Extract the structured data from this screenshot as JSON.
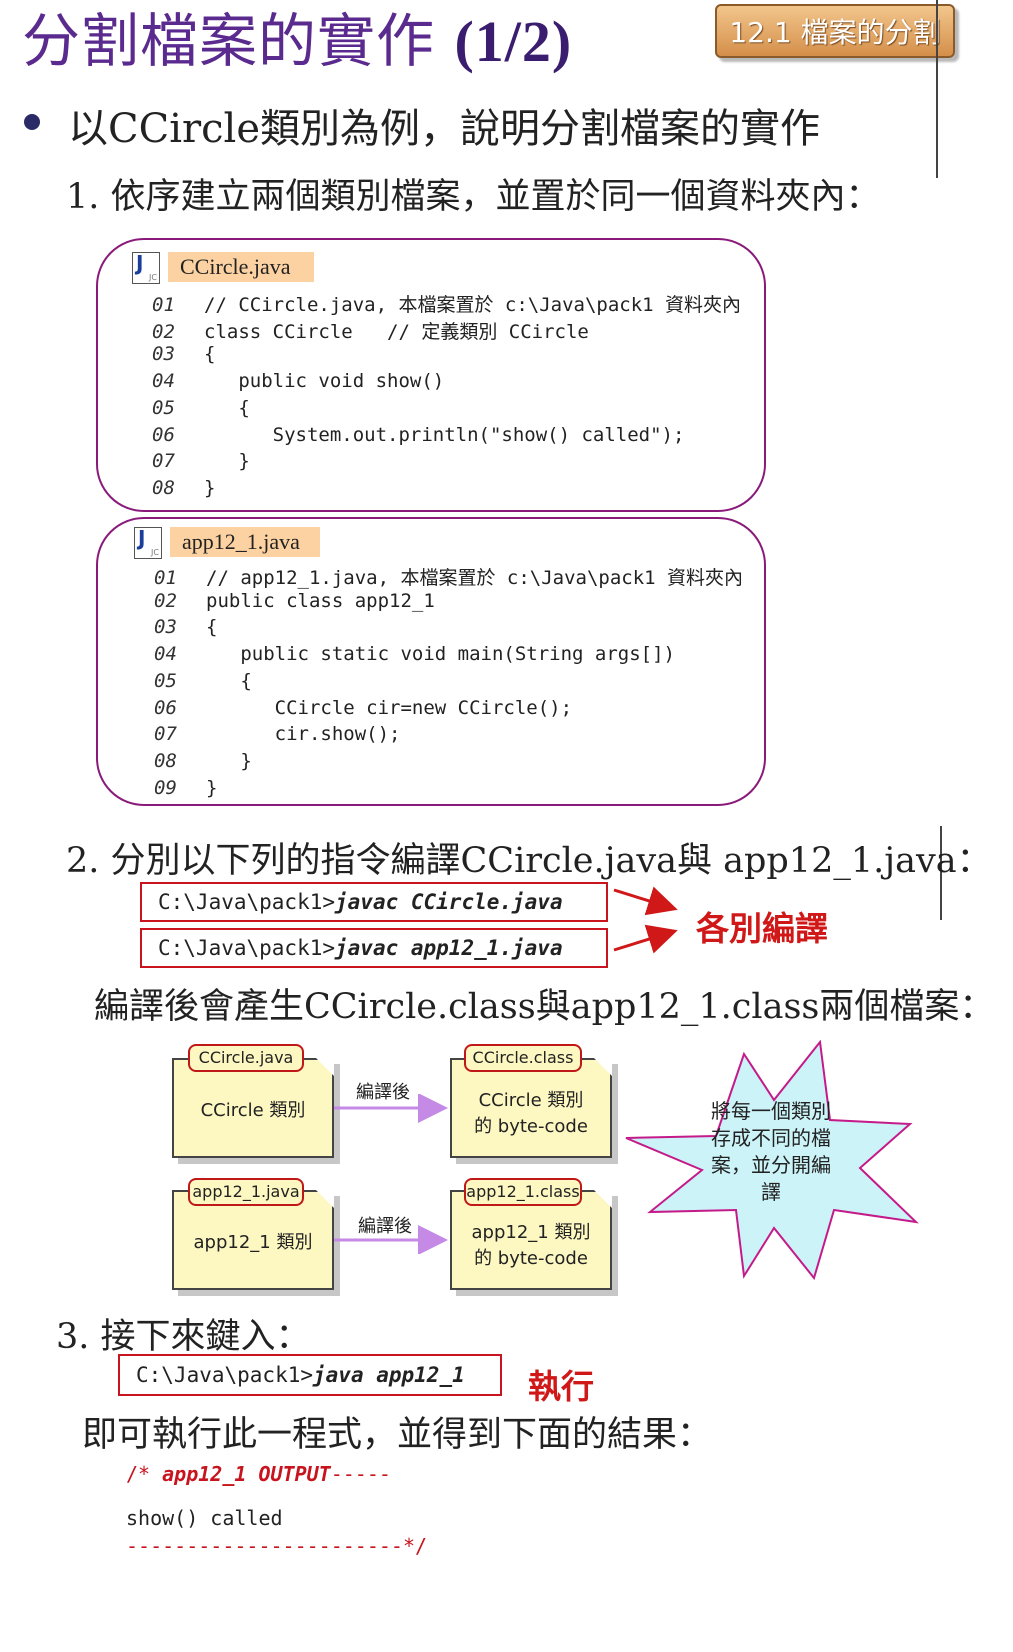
{
  "header": {
    "title_text": "分割檔案的實作 ",
    "title_num": "(1/2)",
    "badge": "12.1  檔案的分割"
  },
  "bullet": "以CCircle類別為例，說明分割檔案的實作",
  "step1": "1. 依序建立兩個類別檔案，並置於同一個資料夾內：",
  "file1": {
    "name": "CCircle.java",
    "lines": [
      {
        "n": "01",
        "code": "// CCircle.java, 本檔案置於 c:\\Java\\pack1 資料夾內"
      },
      {
        "n": "02",
        "code": "class CCircle   // 定義類別 CCircle"
      },
      {
        "n": "03",
        "code": "{"
      },
      {
        "n": "04",
        "code": "   public void show()"
      },
      {
        "n": "05",
        "code": "   {"
      },
      {
        "n": "06",
        "code": "      System.out.println(\"show() called\");"
      },
      {
        "n": "07",
        "code": "   }"
      },
      {
        "n": "08",
        "code": "}"
      }
    ]
  },
  "file2": {
    "name": "app12_1.java",
    "lines": [
      {
        "n": "01",
        "code": "// app12_1.java, 本檔案置於 c:\\Java\\pack1 資料夾內"
      },
      {
        "n": "02",
        "code": "public class app12_1"
      },
      {
        "n": "03",
        "code": "{"
      },
      {
        "n": "04",
        "code": "   public static void main(String args[])"
      },
      {
        "n": "05",
        "code": "   {"
      },
      {
        "n": "06",
        "code": "      CCircle cir=new CCircle();"
      },
      {
        "n": "07",
        "code": "      cir.show();"
      },
      {
        "n": "08",
        "code": "   }"
      },
      {
        "n": "09",
        "code": "}"
      }
    ]
  },
  "step2": "2. 分別以下列的指令編譯CCircle.java與 app12_1.java：",
  "compile": {
    "prompt": "C:\\Java\\pack1>",
    "cmd1": "javac CCircle.java",
    "cmd2": "javac app12_1.java",
    "label": "各別編譯"
  },
  "after_compile": "編譯後會產生CCircle.class與app12_1.class兩個檔案：",
  "diagram": {
    "src1_tab": "CCircle.java",
    "src1_text": "CCircle 類別",
    "out1_tab": "CCircle.class",
    "out1_line1": "CCircle 類別",
    "out1_line2": "的 byte-code",
    "src2_tab": "app12_1.java",
    "src2_text": "app12_1 類別",
    "out2_tab": "app12_1.class",
    "out2_line1": "app12_1 類別",
    "out2_line2": "的 byte-code",
    "arrow_label": "編譯後",
    "starburst": [
      "將每一個類別",
      "存成不同的檔",
      "案，並分開編",
      "譯"
    ],
    "colors": {
      "doc_fill": "#fdf7c2",
      "arrow": "#c48ae6",
      "star_fill": "#ccf3f8",
      "star_stroke": "#c41a8a"
    }
  },
  "step3": "3. 接下來鍵入：",
  "run": {
    "prompt": "C:\\Java\\pack1>",
    "cmd": "java app12_1",
    "label": "執行"
  },
  "result_text": "即可執行此一程式，並得到下面的結果：",
  "output": {
    "header_prefix": "/* ",
    "header_name": "app12_1 OUTPUT",
    "header_dashes": "-----",
    "line": "show() called",
    "footer": "-----------------------*/"
  },
  "colors": {
    "title": "#5a2a8e",
    "code_border": "#8a1a7a",
    "tab_fill": "#fcd2a2",
    "cmd_border": "#c8141e"
  }
}
